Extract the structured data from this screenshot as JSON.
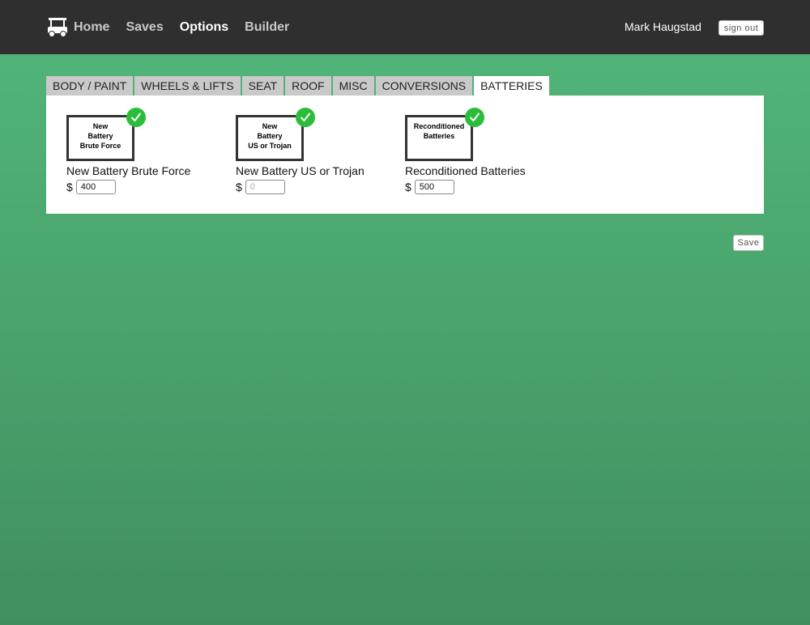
{
  "header": {
    "logo_icon": "golf-cart-icon",
    "nav": [
      {
        "label": "Home",
        "active": false
      },
      {
        "label": "Saves",
        "active": false
      },
      {
        "label": "Options",
        "active": true
      },
      {
        "label": "Builder",
        "active": false
      }
    ],
    "user_name": "Mark Haugstad",
    "signout_label": "sign out"
  },
  "tabs": [
    {
      "label": "BODY / PAINT",
      "active": false
    },
    {
      "label": "WHEELS & LIFTS",
      "active": false
    },
    {
      "label": "SEAT",
      "active": false
    },
    {
      "label": "ROOF",
      "active": false
    },
    {
      "label": "MISC",
      "active": false
    },
    {
      "label": "CONVERSIONS",
      "active": false
    },
    {
      "label": "BATTERIES",
      "active": true
    }
  ],
  "items": [
    {
      "thumb_text": "New\nBattery\nBrute Force",
      "name": "New Battery Brute Force",
      "currency": "$",
      "price_value": "400",
      "price_placeholder": "",
      "checked": true
    },
    {
      "thumb_text": "New\nBattery\nUS or Trojan",
      "name": "New Battery US or Trojan",
      "currency": "$",
      "price_value": "",
      "price_placeholder": "0",
      "checked": true
    },
    {
      "thumb_text": "Reconditioned\nBatteries",
      "name": "Reconditioned Batteries",
      "currency": "$",
      "price_value": "500",
      "price_placeholder": "",
      "checked": true
    }
  ],
  "save_label": "Save",
  "colors": {
    "topbar": "#2f2f2f",
    "check": "#2bbd3a",
    "background_green": "#4aa66e"
  }
}
